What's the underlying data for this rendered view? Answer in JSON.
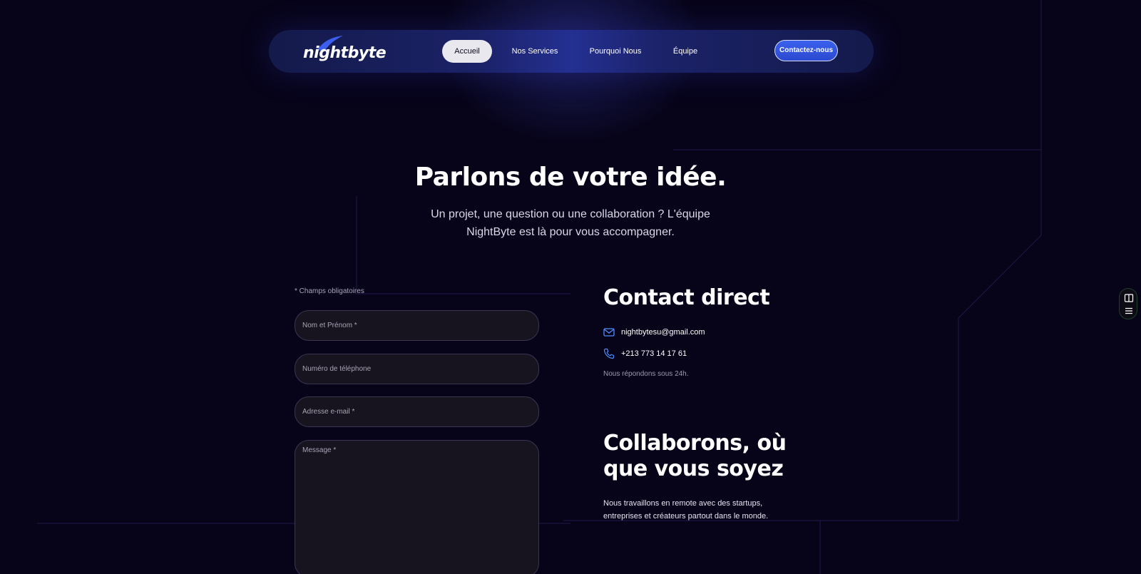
{
  "nav": {
    "logo_text": "nightbyte",
    "items": [
      {
        "label": "Accueil",
        "active": true
      },
      {
        "label": "Nos Services",
        "active": false
      },
      {
        "label": "Pourquoi Nous",
        "active": false
      },
      {
        "label": "Équipe",
        "active": false
      }
    ],
    "cta_label": "Contactez-nous"
  },
  "hero": {
    "title": "Parlons de votre idée.",
    "subtitle": "Un projet, une question ou une collaboration ? L'équipe NightByte est là pour vous accompagner."
  },
  "form": {
    "required_note": "* Champs obligatoires",
    "name_placeholder": "Nom et Prénom *",
    "phone_placeholder": "Numéro de téléphone",
    "email_placeholder": "Adresse e-mail *",
    "message_placeholder": "Message *"
  },
  "contact": {
    "title": "Contact direct",
    "email": "nightbytesu@gmail.com",
    "phone": "+213 773 14 17 61",
    "response_note": "Nous répondons sous 24h."
  },
  "collab": {
    "title": "Collaborons, où que vous soyez",
    "text": "Nous travaillons en remote avec des startups, entreprises et créateurs partout dans le monde."
  },
  "colors": {
    "background": "#07041a",
    "nav_center": "#243092",
    "cta": "#3a61ee",
    "icon_accent": "#4f8dff"
  },
  "icons": [
    "mail-icon",
    "phone-icon",
    "book-icon",
    "menu-icon"
  ]
}
